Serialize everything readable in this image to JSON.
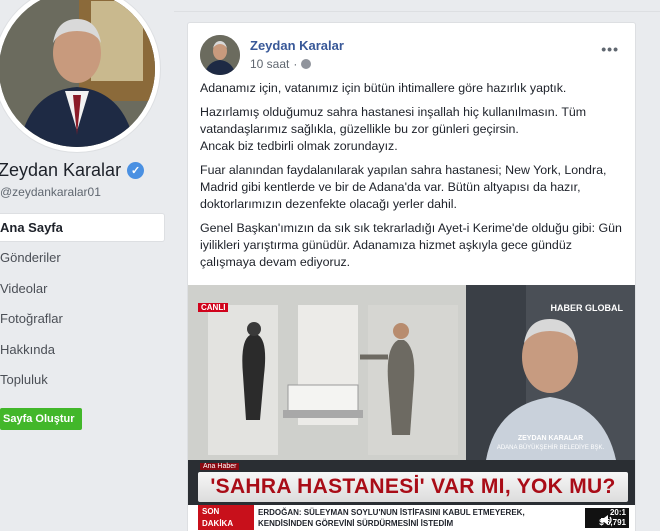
{
  "sidebar": {
    "page_name": "Zeydan Karalar",
    "handle": "@zeydankaralar01",
    "nav": [
      {
        "label": "Ana Sayfa",
        "active": true
      },
      {
        "label": "Gönderiler",
        "active": false
      },
      {
        "label": "Videolar",
        "active": false
      },
      {
        "label": "Fotoğraflar",
        "active": false
      },
      {
        "label": "Hakkında",
        "active": false
      },
      {
        "label": "Topluluk",
        "active": false
      }
    ],
    "create_page_label": "Sayfa Oluştur"
  },
  "post": {
    "author": "Zeydan Karalar",
    "time": "10 saat",
    "more": "•••",
    "paragraphs": [
      "Adanamız için, vatanımız için bütün ihtimallere göre hazırlık yaptık.",
      "Hazırlamış olduğumuz sahra hastanesi inşallah hiç kullanılmasın. Tüm vatandaşlarımız sağlıkla, güzellikle bu zor günleri geçirsin.\nAncak biz tedbirli olmak zorundayız.",
      "Fuar alanından faydalanılarak yapılan sahra hastanesi; New York, Londra, Madrid gibi kentlerde ve bir de Adana'da var. Bütün altyapısı da hazır, doktorlarımızın dezenfekte olacağı yerler dahil.",
      "Genel Başkan'ımızın da sık sık tekrarladığı Ayet-i Kerime'de olduğu gibi: Gün iyilikleri yarıştırma günüdür. Adanamıza hizmet aşkıyla gece gündüz çalışmaya devam ediyoruz."
    ]
  },
  "video": {
    "live_label": "CANLI",
    "channel_logo": "HABER GLOBAL",
    "guest_name": "ZEYDAN KARALAR",
    "guest_title": "ADANA BÜYÜKŞEHİR BELEDİYE BŞK.",
    "program": "Ana Haber",
    "headline": "'SAHRA HASTANESİ' VAR MI, YOK MU?",
    "ticker_tag": "SON DAKİKA",
    "ticker_text": "ERDOĞAN: SÜLEYMAN SOYLU'NUN İSTİFASINI KABUL ETMEYEREK, KENDİSİNDEN GÖREVİNİ SÜRDÜRMESİNİ İSTEDİM",
    "clock": "20:1",
    "ticker_value": "$ 6,791"
  }
}
